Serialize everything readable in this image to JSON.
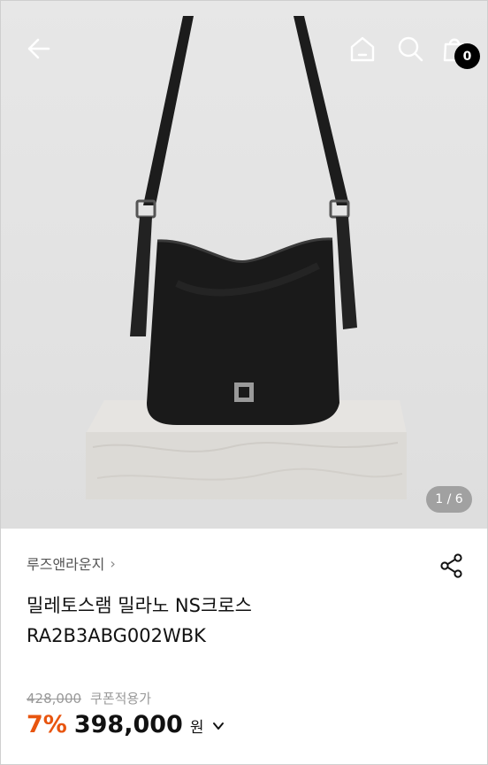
{
  "header": {
    "back_icon": "arrow-left-icon",
    "home_icon": "home-icon",
    "search_icon": "search-icon",
    "cart_icon": "shopping-bag-icon",
    "cart_count": "0"
  },
  "gallery": {
    "indicator": "1 / 6"
  },
  "product": {
    "brand": "루즈앤라운지",
    "brand_chevron": "›",
    "name_line1": "밀레토스램 밀라노 NS크로스",
    "name_line2": "RA2B3ABG002WBK",
    "original_price": "428,000",
    "coupon_label": "쿠폰적용가",
    "discount": "7%",
    "price": "398,000",
    "currency": "원"
  },
  "colors": {
    "discount": "#e8550f",
    "badge": "#000000"
  }
}
